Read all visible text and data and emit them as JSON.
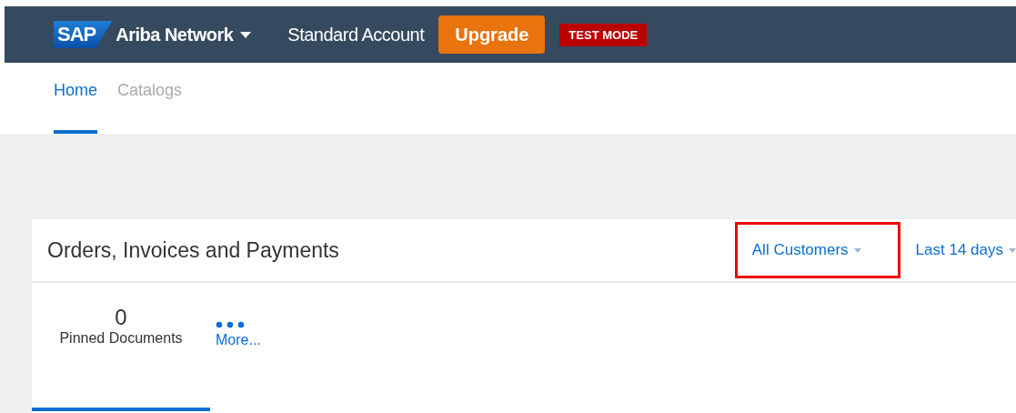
{
  "header": {
    "logo": "SAP",
    "product": "Ariba Network",
    "account": "Standard Account",
    "upgrade": "Upgrade",
    "mode_badge": "TEST MODE"
  },
  "tabs": [
    {
      "label": "Home",
      "selected": true
    },
    {
      "label": "Catalogs",
      "selected": false
    }
  ],
  "panel": {
    "title": "Orders, Invoices and Payments",
    "filters": [
      {
        "label": "All Customers",
        "highlighted": true
      },
      {
        "label": "Last 14 days",
        "highlighted": false
      }
    ],
    "tiles": [
      {
        "kind": "count",
        "count": "0",
        "label": "Pinned Documents",
        "selected": true
      },
      {
        "kind": "more",
        "label": "More...",
        "selected": false
      }
    ]
  }
}
